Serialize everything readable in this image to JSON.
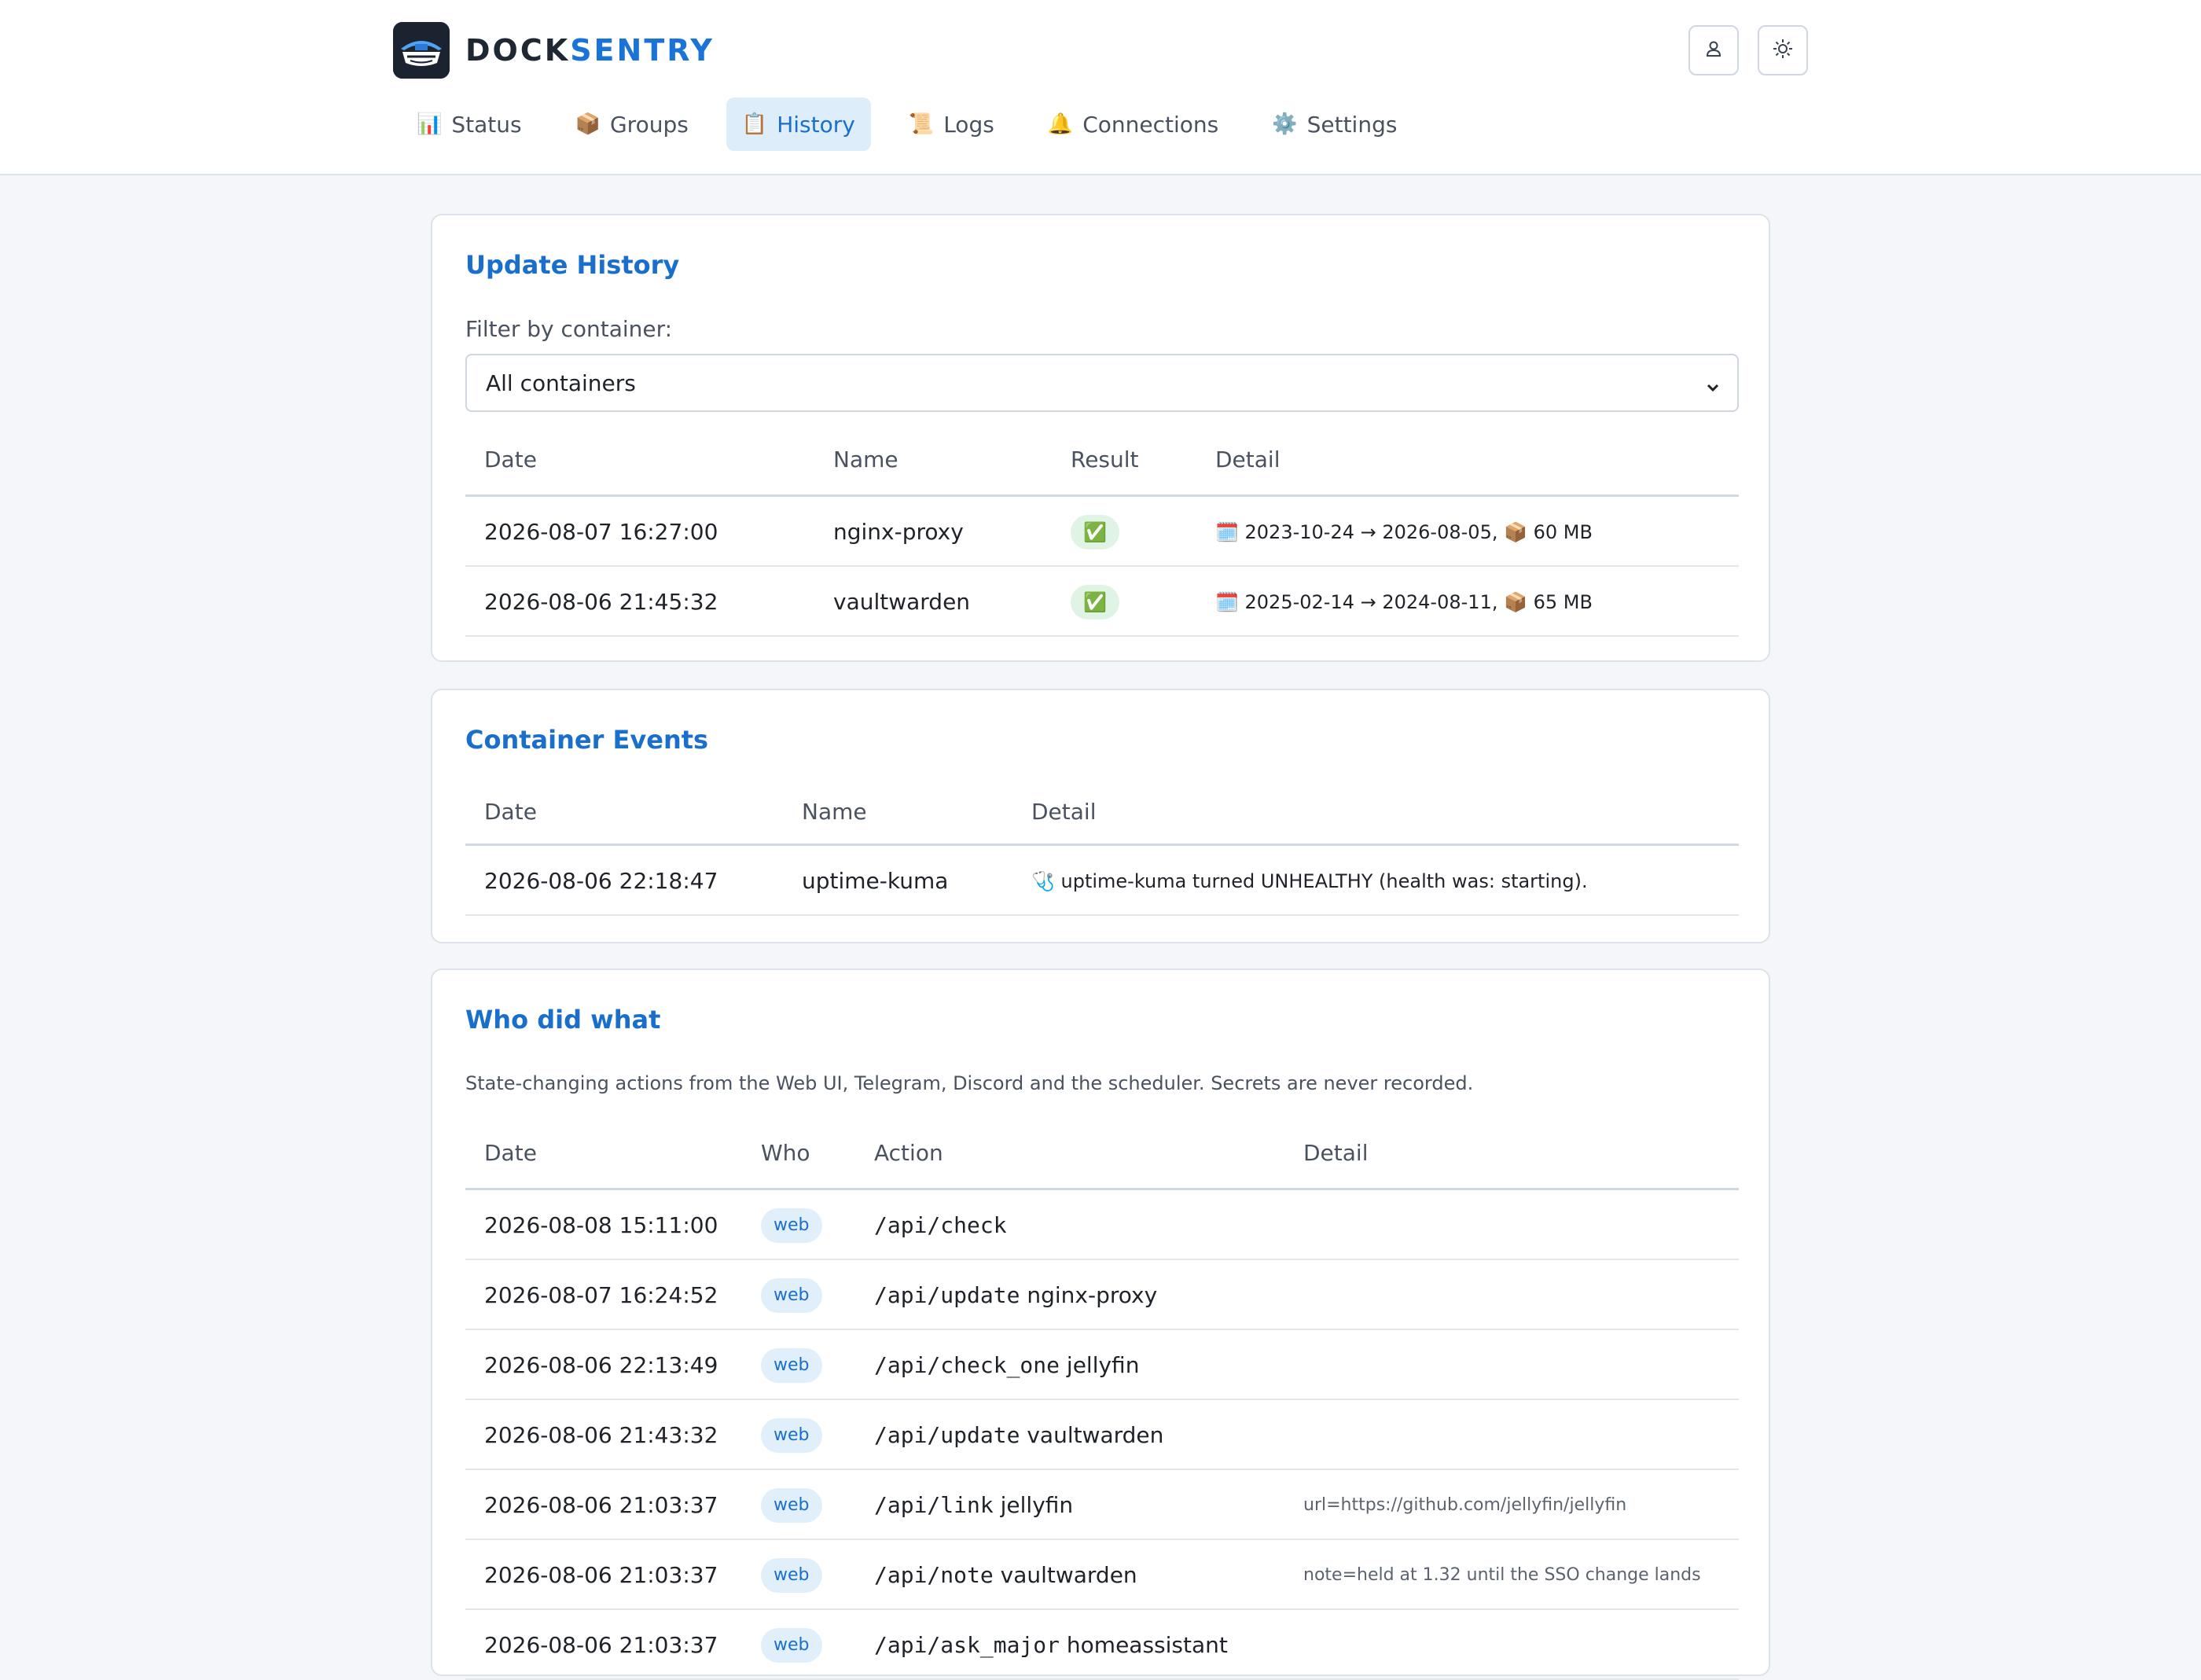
{
  "header": {
    "brand_part1": "DOCK",
    "brand_part2": "SENTRY",
    "icons": {
      "user": "user-icon",
      "theme": "sun-icon",
      "logo": "docksentry-logo"
    }
  },
  "nav": {
    "tabs": [
      {
        "icon": "📊",
        "label": "Status"
      },
      {
        "icon": "📦",
        "label": "Groups"
      },
      {
        "icon": "📋",
        "label": "History",
        "active": true
      },
      {
        "icon": "📜",
        "label": "Logs"
      },
      {
        "icon": "🔔",
        "label": "Connections"
      },
      {
        "icon": "⚙️",
        "label": "Settings"
      }
    ]
  },
  "update_history": {
    "title": "Update History",
    "filter_label": "Filter by container:",
    "filter_value": "All containers",
    "columns": [
      "Date",
      "Name",
      "Result",
      "Detail"
    ],
    "rows": [
      {
        "date": "2026-08-07 16:27:00",
        "name": "nginx-proxy",
        "result": "✅",
        "detail": "🗓️ 2023-10-24 → 2026-08-05, 📦 60 MB"
      },
      {
        "date": "2026-08-06 21:45:32",
        "name": "vaultwarden",
        "result": "✅",
        "detail": "🗓️ 2025-02-14 → 2024-08-11, 📦 65 MB"
      }
    ]
  },
  "container_events": {
    "title": "Container Events",
    "columns": [
      "Date",
      "Name",
      "Detail"
    ],
    "rows": [
      {
        "date": "2026-08-06 22:18:47",
        "name": "uptime-kuma",
        "detail": "🩺 uptime-kuma turned UNHEALTHY (health was: starting)."
      }
    ]
  },
  "who_did_what": {
    "title": "Who did what",
    "description": "State-changing actions from the Web UI, Telegram, Discord and the scheduler. Secrets are never recorded.",
    "columns": [
      "Date",
      "Who",
      "Action",
      "Detail"
    ],
    "rows": [
      {
        "date": "2026-08-08 15:11:00",
        "who": "web",
        "action": "/api/check",
        "target": "",
        "detail": ""
      },
      {
        "date": "2026-08-07 16:24:52",
        "who": "web",
        "action": "/api/update",
        "target": "nginx-proxy",
        "detail": ""
      },
      {
        "date": "2026-08-06 22:13:49",
        "who": "web",
        "action": "/api/check_one",
        "target": "jellyfin",
        "detail": ""
      },
      {
        "date": "2026-08-06 21:43:32",
        "who": "web",
        "action": "/api/update",
        "target": "vaultwarden",
        "detail": ""
      },
      {
        "date": "2026-08-06 21:03:37",
        "who": "web",
        "action": "/api/link",
        "target": "jellyfin",
        "detail": "url=https://github.com/jellyfin/jellyfin"
      },
      {
        "date": "2026-08-06 21:03:37",
        "who": "web",
        "action": "/api/note",
        "target": "vaultwarden",
        "detail": "note=held at 1.32 until the SSO change lands"
      },
      {
        "date": "2026-08-06 21:03:37",
        "who": "web",
        "action": "/api/ask_major",
        "target": "homeassistant",
        "detail": ""
      }
    ]
  }
}
